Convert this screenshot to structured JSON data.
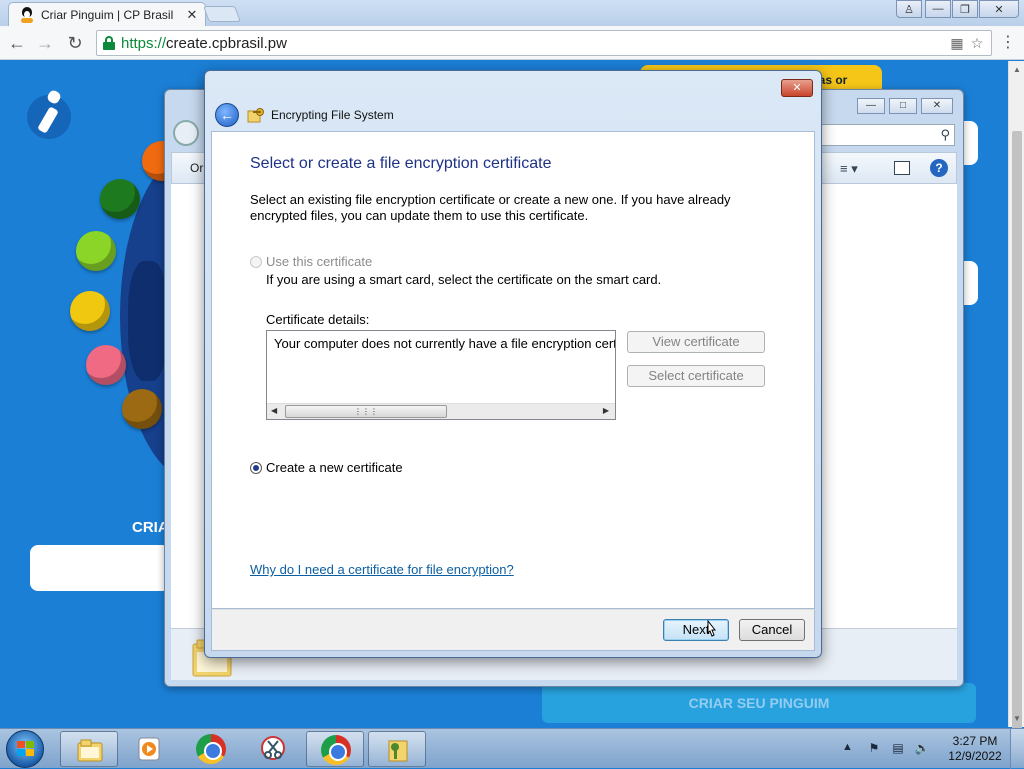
{
  "browser": {
    "tab_title": "Criar Pinguim | CP Brasil",
    "tab_close": "✕",
    "url_scheme": "https://",
    "url_host": "create.cpbrasil.pw"
  },
  "page": {
    "promo_text": "ras or",
    "heading": "CRIA",
    "create_button": "CRIAR SEU PINGUIM"
  },
  "explorer": {
    "command_organize": "Or"
  },
  "dialog": {
    "title": "Encrypting File System",
    "close_label": "✕",
    "heading": "Select or create a file encryption certificate",
    "intro": "Select an existing file encryption certificate or create a new one. If you have already encrypted files, you can update them to use this certificate.",
    "use_cert_label": "Use this certificate",
    "use_cert_sub": "If you are using a smart card, select the certificate on the smart card.",
    "cert_details_label": "Certificate details:",
    "cert_details_text": "Your computer does not currently have a file encryption certificate.",
    "view_cert_button": "View certificate",
    "select_cert_button": "Select certificate",
    "create_new_label": "Create a new certificate",
    "help_link": "Why do I need a certificate for file encryption?",
    "next_button": "Next",
    "cancel_button": "Cancel",
    "selected_option": "create_new"
  },
  "taskbar": {
    "clock_time": "3:27 PM",
    "clock_date": "12/9/2022",
    "pinned": [
      "windows-explorer",
      "media-player",
      "chrome",
      "snipping-tool",
      "chrome",
      "encrypting-file-system"
    ]
  },
  "colors": {
    "page_bg": "#1b7fd6",
    "dialog_heading": "#1e3287",
    "link": "#0b5fa3",
    "url_secure": "#0b8a3a"
  }
}
